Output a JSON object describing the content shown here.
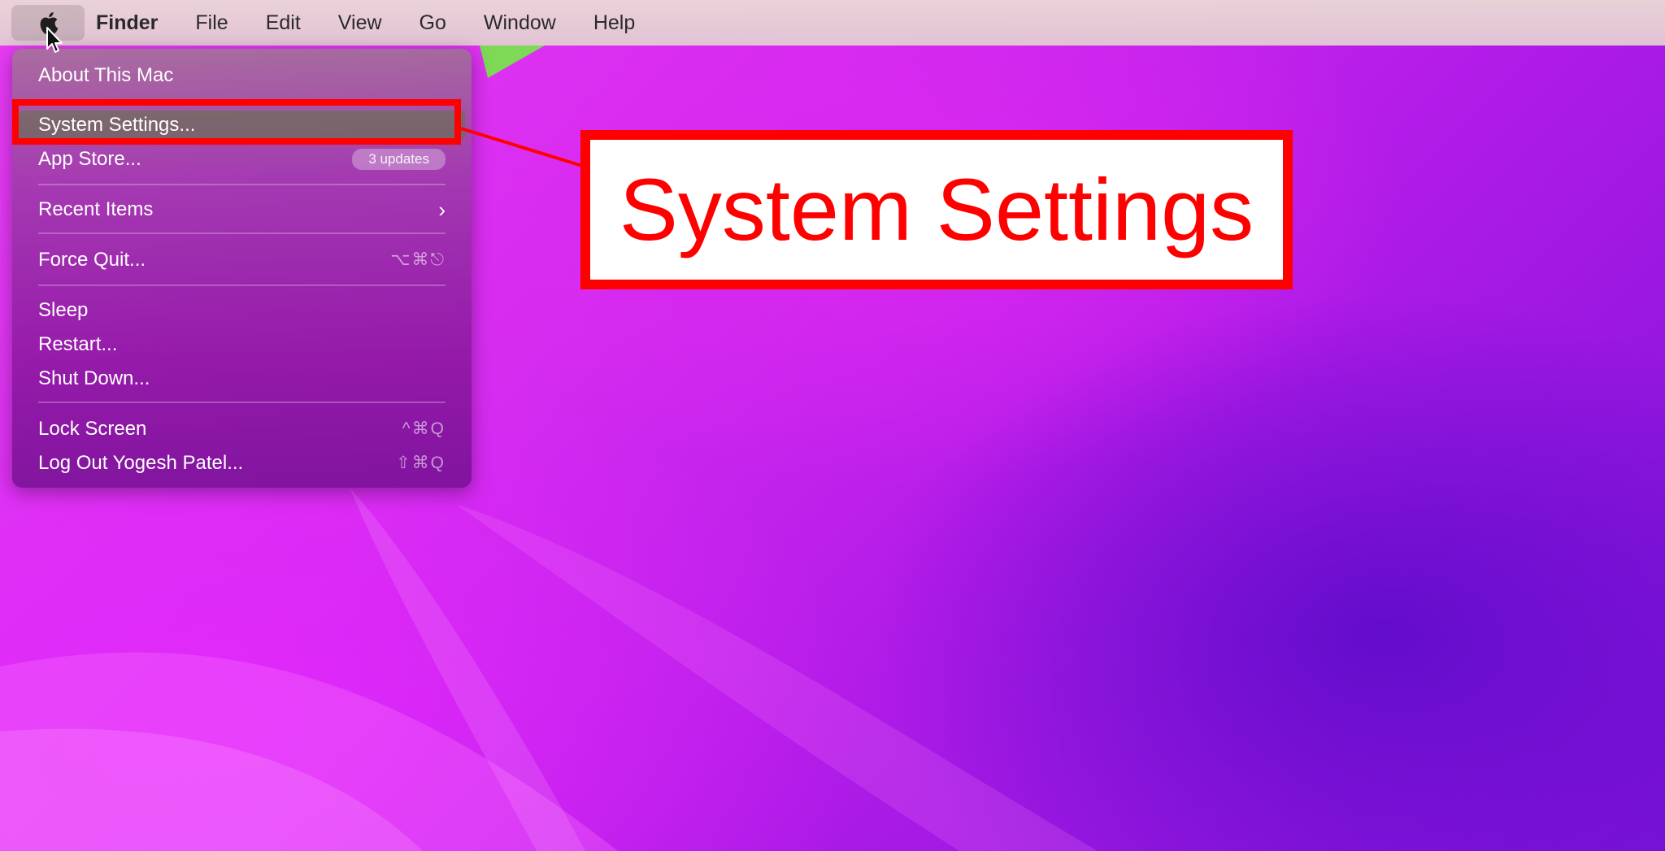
{
  "menubar": {
    "app_name": "Finder",
    "menus": [
      "File",
      "Edit",
      "View",
      "Go",
      "Window",
      "Help"
    ],
    "apple_icon": "apple-logo-icon"
  },
  "apple_menu": {
    "about": "About This Mac",
    "system_settings": "System Settings...",
    "app_store": "App Store...",
    "app_store_badge": "3 updates",
    "recent_items": "Recent Items",
    "recent_items_icon": "chevron-right-icon",
    "force_quit": "Force Quit...",
    "force_quit_shortcut": "⌥⌘⎋",
    "sleep": "Sleep",
    "restart": "Restart...",
    "shut_down": "Shut Down...",
    "lock_screen": "Lock Screen",
    "lock_screen_shortcut": "^⌘Q",
    "log_out": "Log Out Yogesh Patel...",
    "log_out_shortcut": "⇧⌘Q"
  },
  "annotation": {
    "callout_text": "System Settings",
    "color": "#ff0000"
  },
  "colors": {
    "wallpaper_primary": "#e83cf6",
    "wallpaper_secondary": "#7a12d8",
    "menubar_bg": "#ead7d8"
  }
}
